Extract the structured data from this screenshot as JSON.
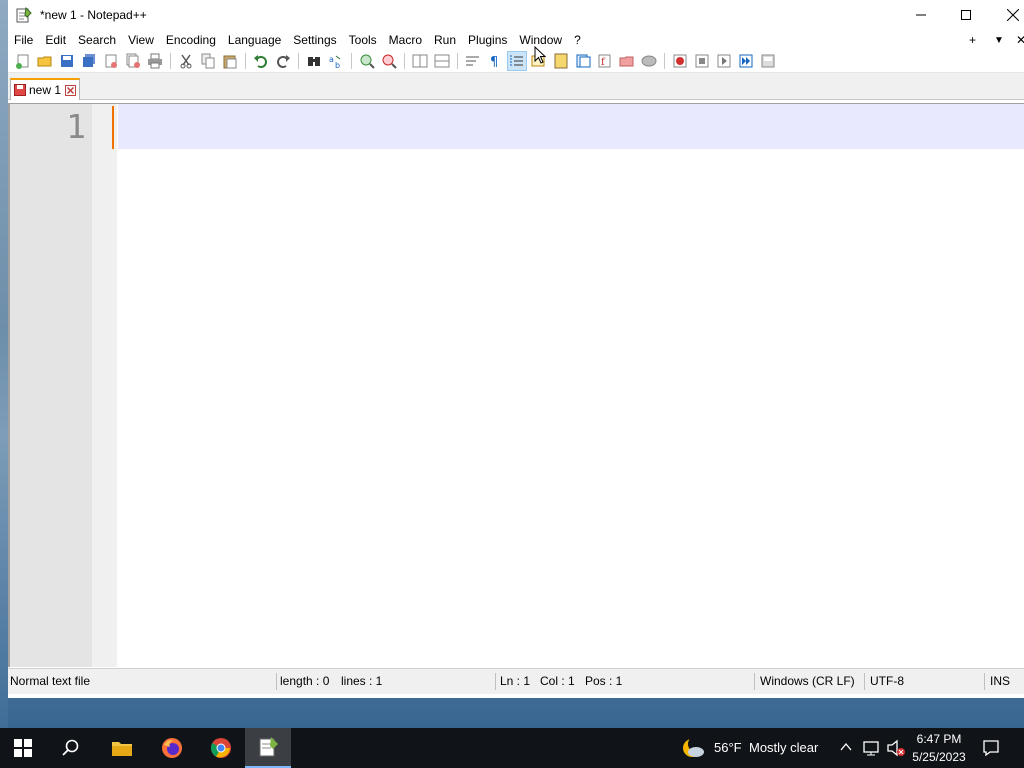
{
  "window": {
    "title": "*new 1 - Notepad++"
  },
  "menu": {
    "items": [
      "File",
      "Edit",
      "Search",
      "View",
      "Encoding",
      "Language",
      "Settings",
      "Tools",
      "Macro",
      "Run",
      "Plugins",
      "Window",
      "?"
    ],
    "right": {
      "plus": "+",
      "dropdown": "▼",
      "close": "✕"
    }
  },
  "tabs": [
    {
      "label": "new 1"
    }
  ],
  "editor": {
    "line_number": "1"
  },
  "status": {
    "file_type": "Normal text file",
    "length": "length : 0",
    "lines": "lines : 1",
    "ln": "Ln : 1",
    "col": "Col : 1",
    "pos": "Pos : 1",
    "eol": "Windows (CR LF)",
    "encoding": "UTF-8",
    "mode": "INS"
  },
  "taskbar": {
    "weather": {
      "temp": "56°F",
      "condition": "Mostly clear"
    },
    "time": "6:47 PM",
    "date": "5/25/2023"
  },
  "colors": {
    "accent_tab": "#f4a000",
    "current_line": "#e8e8ff",
    "caret": "#f07000",
    "taskbar": "#101418"
  }
}
